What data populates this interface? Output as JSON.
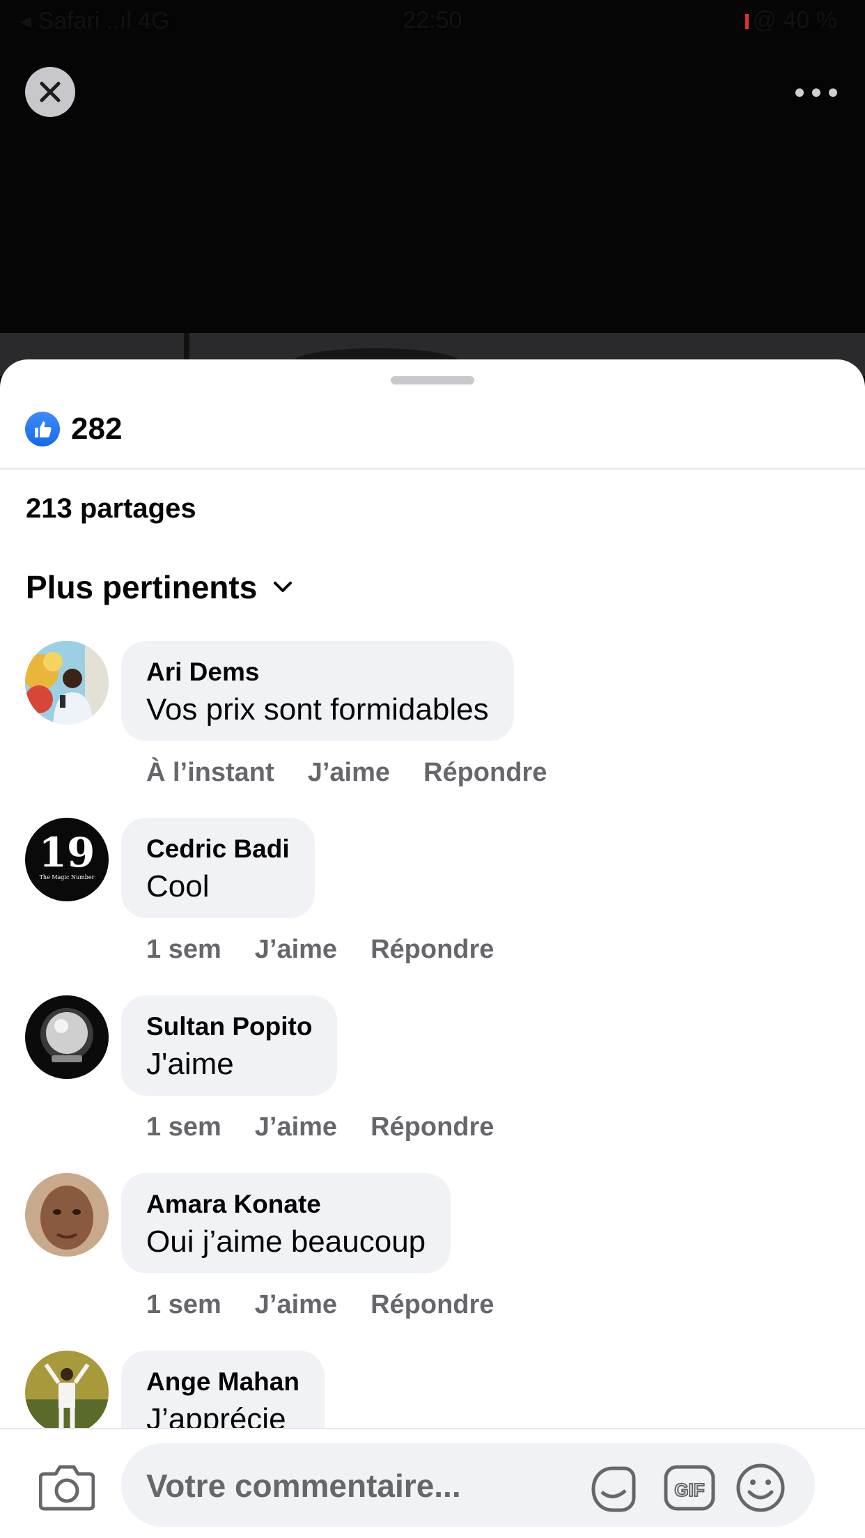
{
  "status_bar": {
    "left": "◂ Safari ..ıl 4G",
    "time": "22:50",
    "battery": "@ 40 %"
  },
  "post": {
    "likes_count": "282",
    "shares": "213 partages",
    "sort_label": "Plus pertinents"
  },
  "comments": [
    {
      "author": "Ari Dems",
      "text": "Vos prix sont formidables",
      "time": "À l’instant",
      "like_label": "J’aime",
      "reply_label": "Répondre"
    },
    {
      "author": "Cedric Badi",
      "text": "Cool",
      "time": "1 sem",
      "like_label": "J’aime",
      "reply_label": "Répondre"
    },
    {
      "author": "Sultan Popito",
      "text": "J'aime",
      "time": "1 sem",
      "like_label": "J’aime",
      "reply_label": "Répondre"
    },
    {
      "author": "Amara Konate",
      "text": "Oui j’aime beaucoup",
      "time": "1 sem",
      "like_label": "J’aime",
      "reply_label": "Répondre"
    },
    {
      "author": "Ange Mahan",
      "text": "J’apprécie"
    }
  ],
  "avatar_texts": {
    "cedric_number": "19",
    "cedric_caption": "The Magic Number"
  },
  "composer": {
    "placeholder": "Votre commentaire...",
    "gif_label": "GIF"
  },
  "colors": {
    "facebook_blue": "#1877f2",
    "secondary_text": "#65676b",
    "bubble_bg": "#f0f2f5"
  }
}
